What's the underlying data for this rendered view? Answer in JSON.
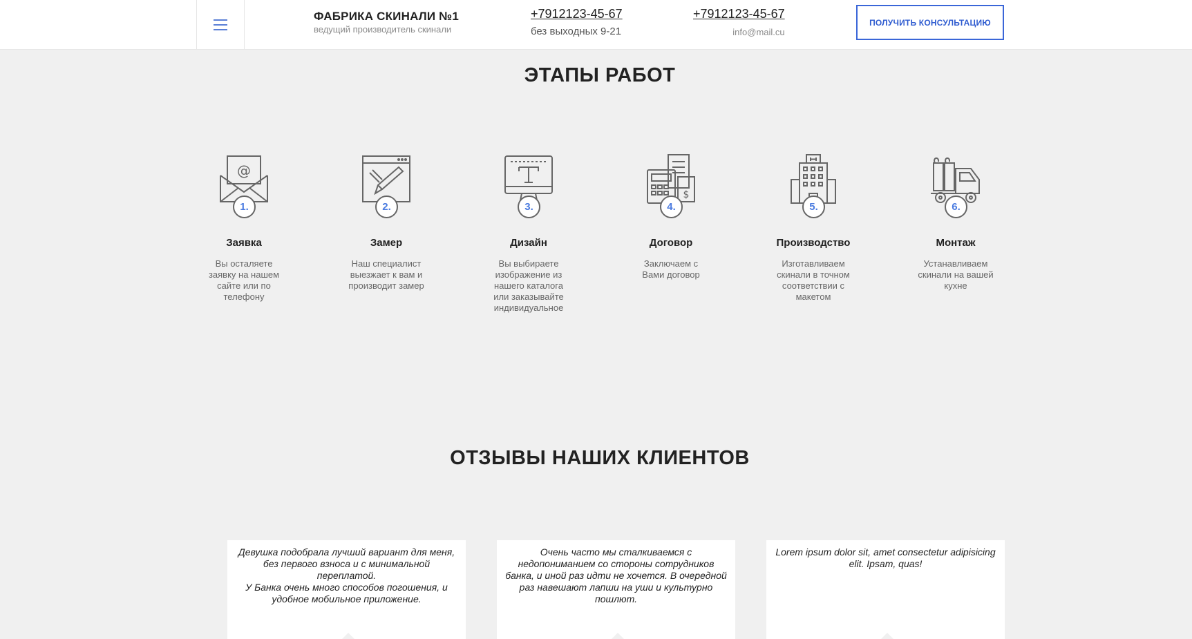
{
  "header": {
    "brand_title": "ФАБРИКА СКИНАЛИ №1",
    "brand_sub": "ведущий производитель скинали",
    "phone1": "+7912123-45-67",
    "hours": "без выходных 9-21",
    "phone2": "+7912123-45-67",
    "email": "info@mail.cu",
    "consult_button": "ПОЛУЧИТЬ КОНСУЛЬТАЦИЮ"
  },
  "steps_section": {
    "title": "ЭТАПЫ РАБОТ",
    "steps": [
      {
        "num": "1.",
        "name": "Заявка",
        "desc": "Вы осталяете заявку на нашем сайте или по телефону",
        "icon": "envelope-icon"
      },
      {
        "num": "2.",
        "name": "Замер",
        "desc": "Наш специалист выезжает к вам и производит замер",
        "icon": "design-pencil-icon"
      },
      {
        "num": "3.",
        "name": "Дизайн",
        "desc": "Вы выбираете изображение из нашего каталога или заказывайте индивидуальное",
        "icon": "monitor-type-icon"
      },
      {
        "num": "4.",
        "name": "Договор",
        "desc": "Заключаем с Вами договор",
        "icon": "calculator-contract-icon"
      },
      {
        "num": "5.",
        "name": "Производство",
        "desc": "Изготавливаем скинали в точном соответствии с макетом",
        "icon": "factory-building-icon"
      },
      {
        "num": "6.",
        "name": "Монтаж",
        "desc": "Устанавливаем скинали на вашей кухне",
        "icon": "delivery-truck-icon"
      }
    ]
  },
  "reviews_section": {
    "title": "ОТЗЫВЫ НАШИХ КЛИЕНТОВ",
    "reviews": [
      {
        "lines": [
          "Девушка подобрала лучший вариант для меня,",
          "без первого взноса и с минимальной переплатой.",
          "У Банка очень много способов погошения, и удобное мобильное приложение."
        ]
      },
      {
        "lines": [
          "Очень часто мы сталкиваемся с недопониманием со стороны сотрудников банка, и иной раз идти не хочется. В очередной",
          "раз навешают лапши на уши и культурно пошлют."
        ]
      },
      {
        "lines": [
          "Lorem ipsum dolor sit, amet consectetur adipisicing elit. Ipsam, quas!"
        ]
      }
    ]
  },
  "colors": {
    "accent": "#3a66d8",
    "number": "#4a7be0",
    "background": "#f0f0f0"
  }
}
